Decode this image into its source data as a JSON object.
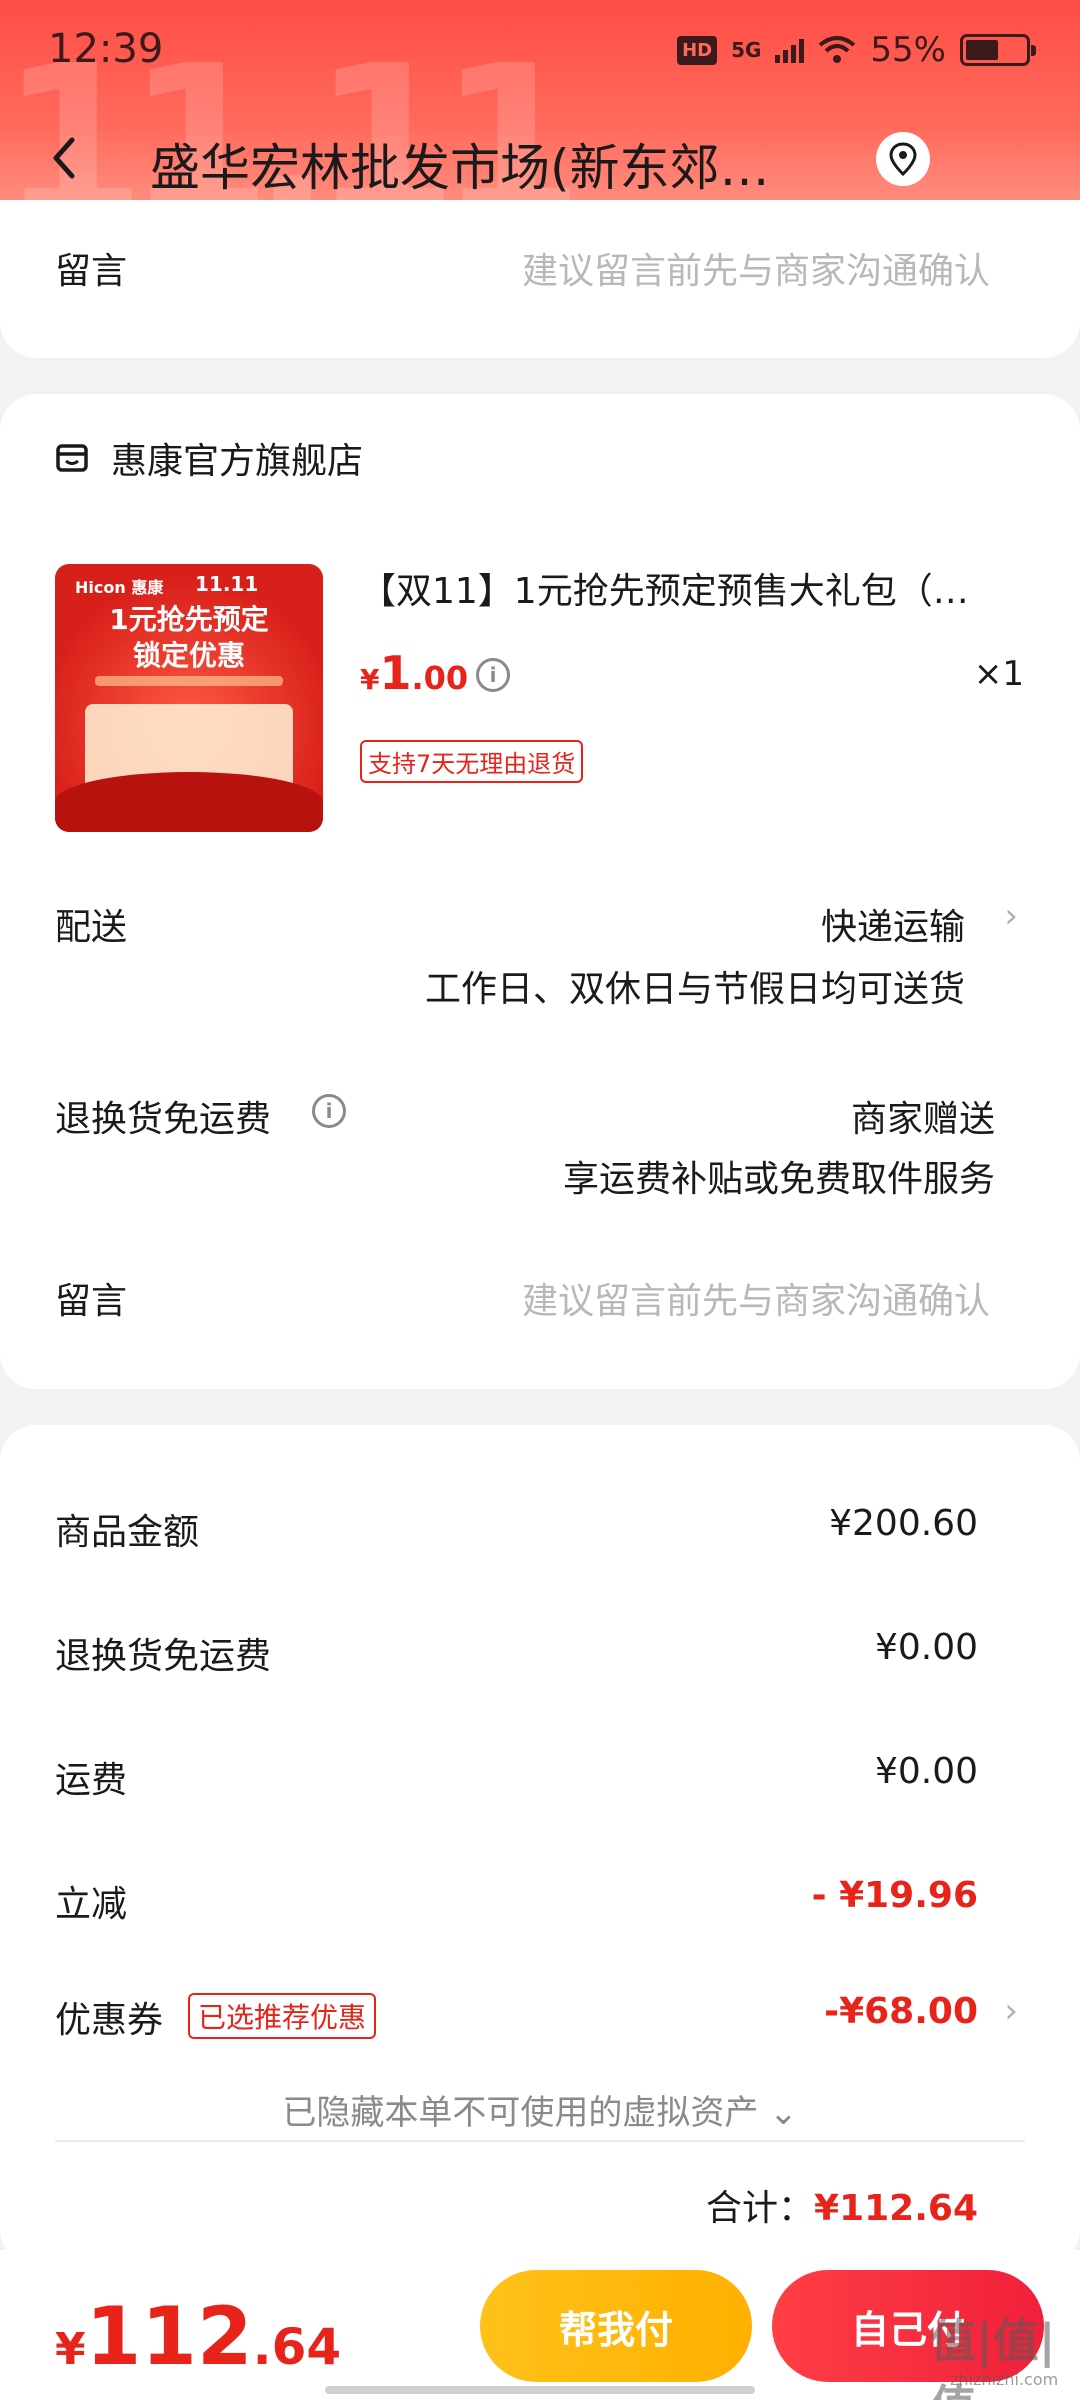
{
  "status_bar": {
    "time": "12:39",
    "hd": "HD",
    "network": "5G",
    "battery": "55%"
  },
  "header": {
    "decoration": "11.11",
    "title": "盛华宏林批发市场(新东郊…"
  },
  "top_card": {
    "message_label": "留言",
    "message_hint": "建议留言前先与商家沟通确认"
  },
  "store": {
    "name": "惠康官方旗舰店",
    "product": {
      "image_brand": "Hicon 惠康",
      "image_badge": "11.11",
      "image_text_line1": "1元抢先预定",
      "image_text_line2": "锁定优惠",
      "title": "【双11】1元抢先预定预售大礼包（…",
      "price_currency": "¥",
      "price_int": "1",
      "price_dec": ".00",
      "quantity": "×1",
      "return_tag": "支持7天无理由退货"
    },
    "delivery": {
      "label": "配送",
      "method": "快递运输",
      "note": "工作日、双休日与节假日均可送货"
    },
    "return_shipping": {
      "label": "退换货免运费",
      "value": "商家赠送",
      "note": "享运费补贴或免费取件服务"
    },
    "message": {
      "label": "留言",
      "hint": "建议留言前先与商家沟通确认"
    }
  },
  "summary": {
    "goods_label": "商品金额",
    "goods_value": "¥200.60",
    "return_label": "退换货免运费",
    "return_value": "¥0.00",
    "shipping_label": "运费",
    "shipping_value": "¥0.00",
    "discount_label": "立减",
    "discount_value": "- ¥19.96",
    "coupon_label": "优惠券",
    "coupon_tag": "已选推荐优惠",
    "coupon_value": "-¥68.00",
    "hidden_assets": "已隐藏本单不可使用的虚拟资产",
    "total_label": "合计：",
    "total_value": "¥112.64"
  },
  "bottom_bar": {
    "price_currency": "¥",
    "price_int": "112",
    "price_dec": ".64",
    "help_pay": "帮我付",
    "self_pay": "自己付"
  },
  "watermark": {
    "text": "值|值|值",
    "sub": "zhizhizhi.com"
  },
  "colors": {
    "accent_red": "#e8231a",
    "help_button": "#ffb800",
    "self_button": "#f0203a",
    "header": "#ff5a4e"
  }
}
